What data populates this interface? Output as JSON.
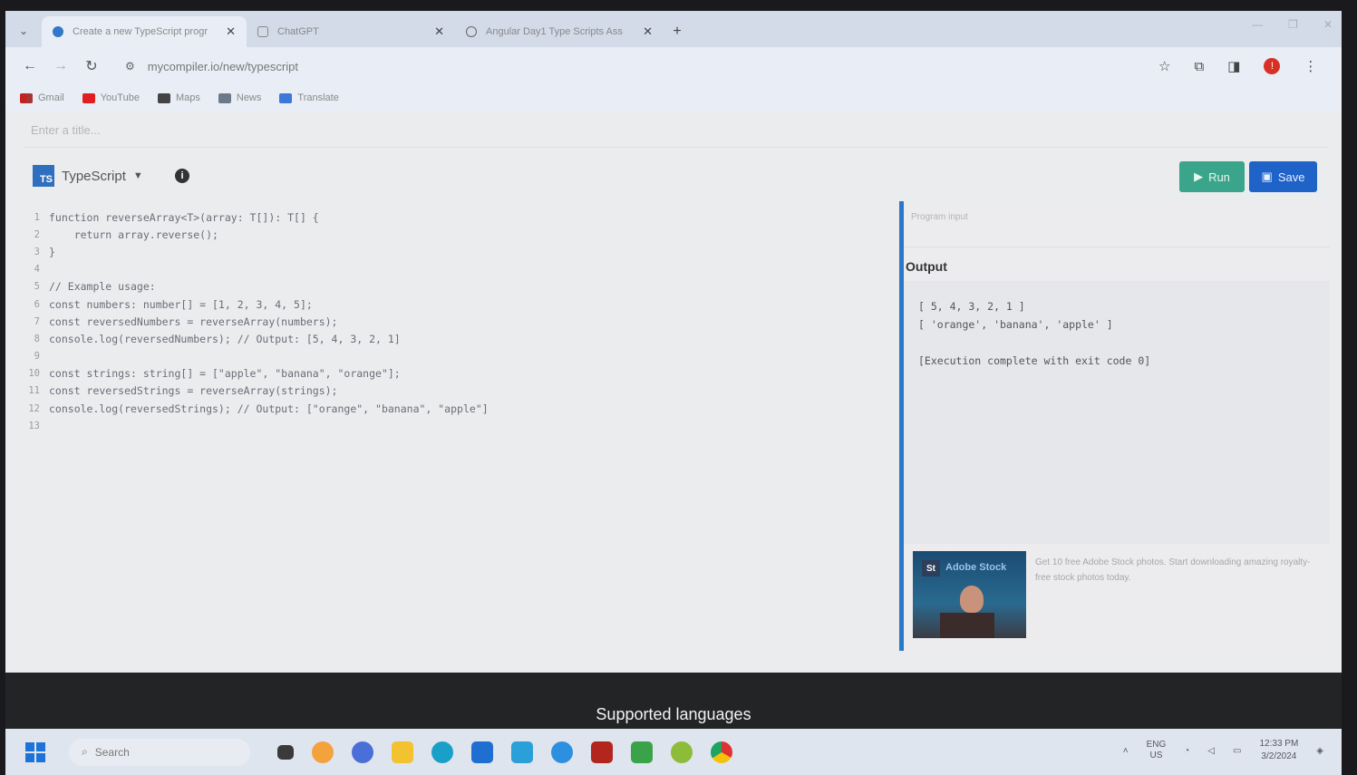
{
  "browser": {
    "tabs": [
      {
        "title": "Create a new TypeScript progr",
        "active": true,
        "favicon": "typescript-logo"
      },
      {
        "title": "ChatGPT",
        "active": false,
        "favicon": "chatgpt-logo"
      },
      {
        "title": "Angular Day1 Type Scripts Ass",
        "active": false,
        "favicon": "globe-icon"
      }
    ],
    "url": "mycompiler.io/new/typescript",
    "bookmarks": [
      "Gmail",
      "YouTube",
      "Maps",
      "News",
      "Translate"
    ]
  },
  "editor_page": {
    "title_placeholder": "Enter a title...",
    "language": "TypeScript",
    "run_label": "Run",
    "save_label": "Save",
    "code_lines": [
      "function reverseArray<T>(array: T[]): T[] {",
      "    return array.reverse();",
      "}",
      "",
      "// Example usage:",
      "const numbers: number[] = [1, 2, 3, 4, 5];",
      "const reversedNumbers = reverseArray(numbers);",
      "console.log(reversedNumbers); // Output: [5, 4, 3, 2, 1]",
      "",
      "const strings: string[] = [\"apple\", \"banana\", \"orange\"];",
      "const reversedStrings = reverseArray(strings);",
      "console.log(reversedStrings); // Output: [\"orange\", \"banana\", \"apple\"]",
      ""
    ],
    "program_input_placeholder": "Program input",
    "output_title": "Output",
    "output_lines": [
      "[ 5, 4, 3, 2, 1 ]",
      "[ 'orange', 'banana', 'apple' ]",
      "",
      "[Execution complete with exit code 0]"
    ],
    "ad": {
      "badge": "St",
      "brand": "Adobe Stock",
      "text": "Get 10 free Adobe Stock photos. Start downloading amazing royalty-free stock photos today."
    }
  },
  "caption": "Supported languages",
  "taskbar": {
    "search_label": "Search",
    "lang_top": "ENG",
    "lang_bottom": "US",
    "time": "12:33 PM",
    "date": "3/2/2024"
  },
  "colors": {
    "run": "#3aa58a",
    "save": "#1f63c8",
    "divider": "#2b78c9"
  }
}
